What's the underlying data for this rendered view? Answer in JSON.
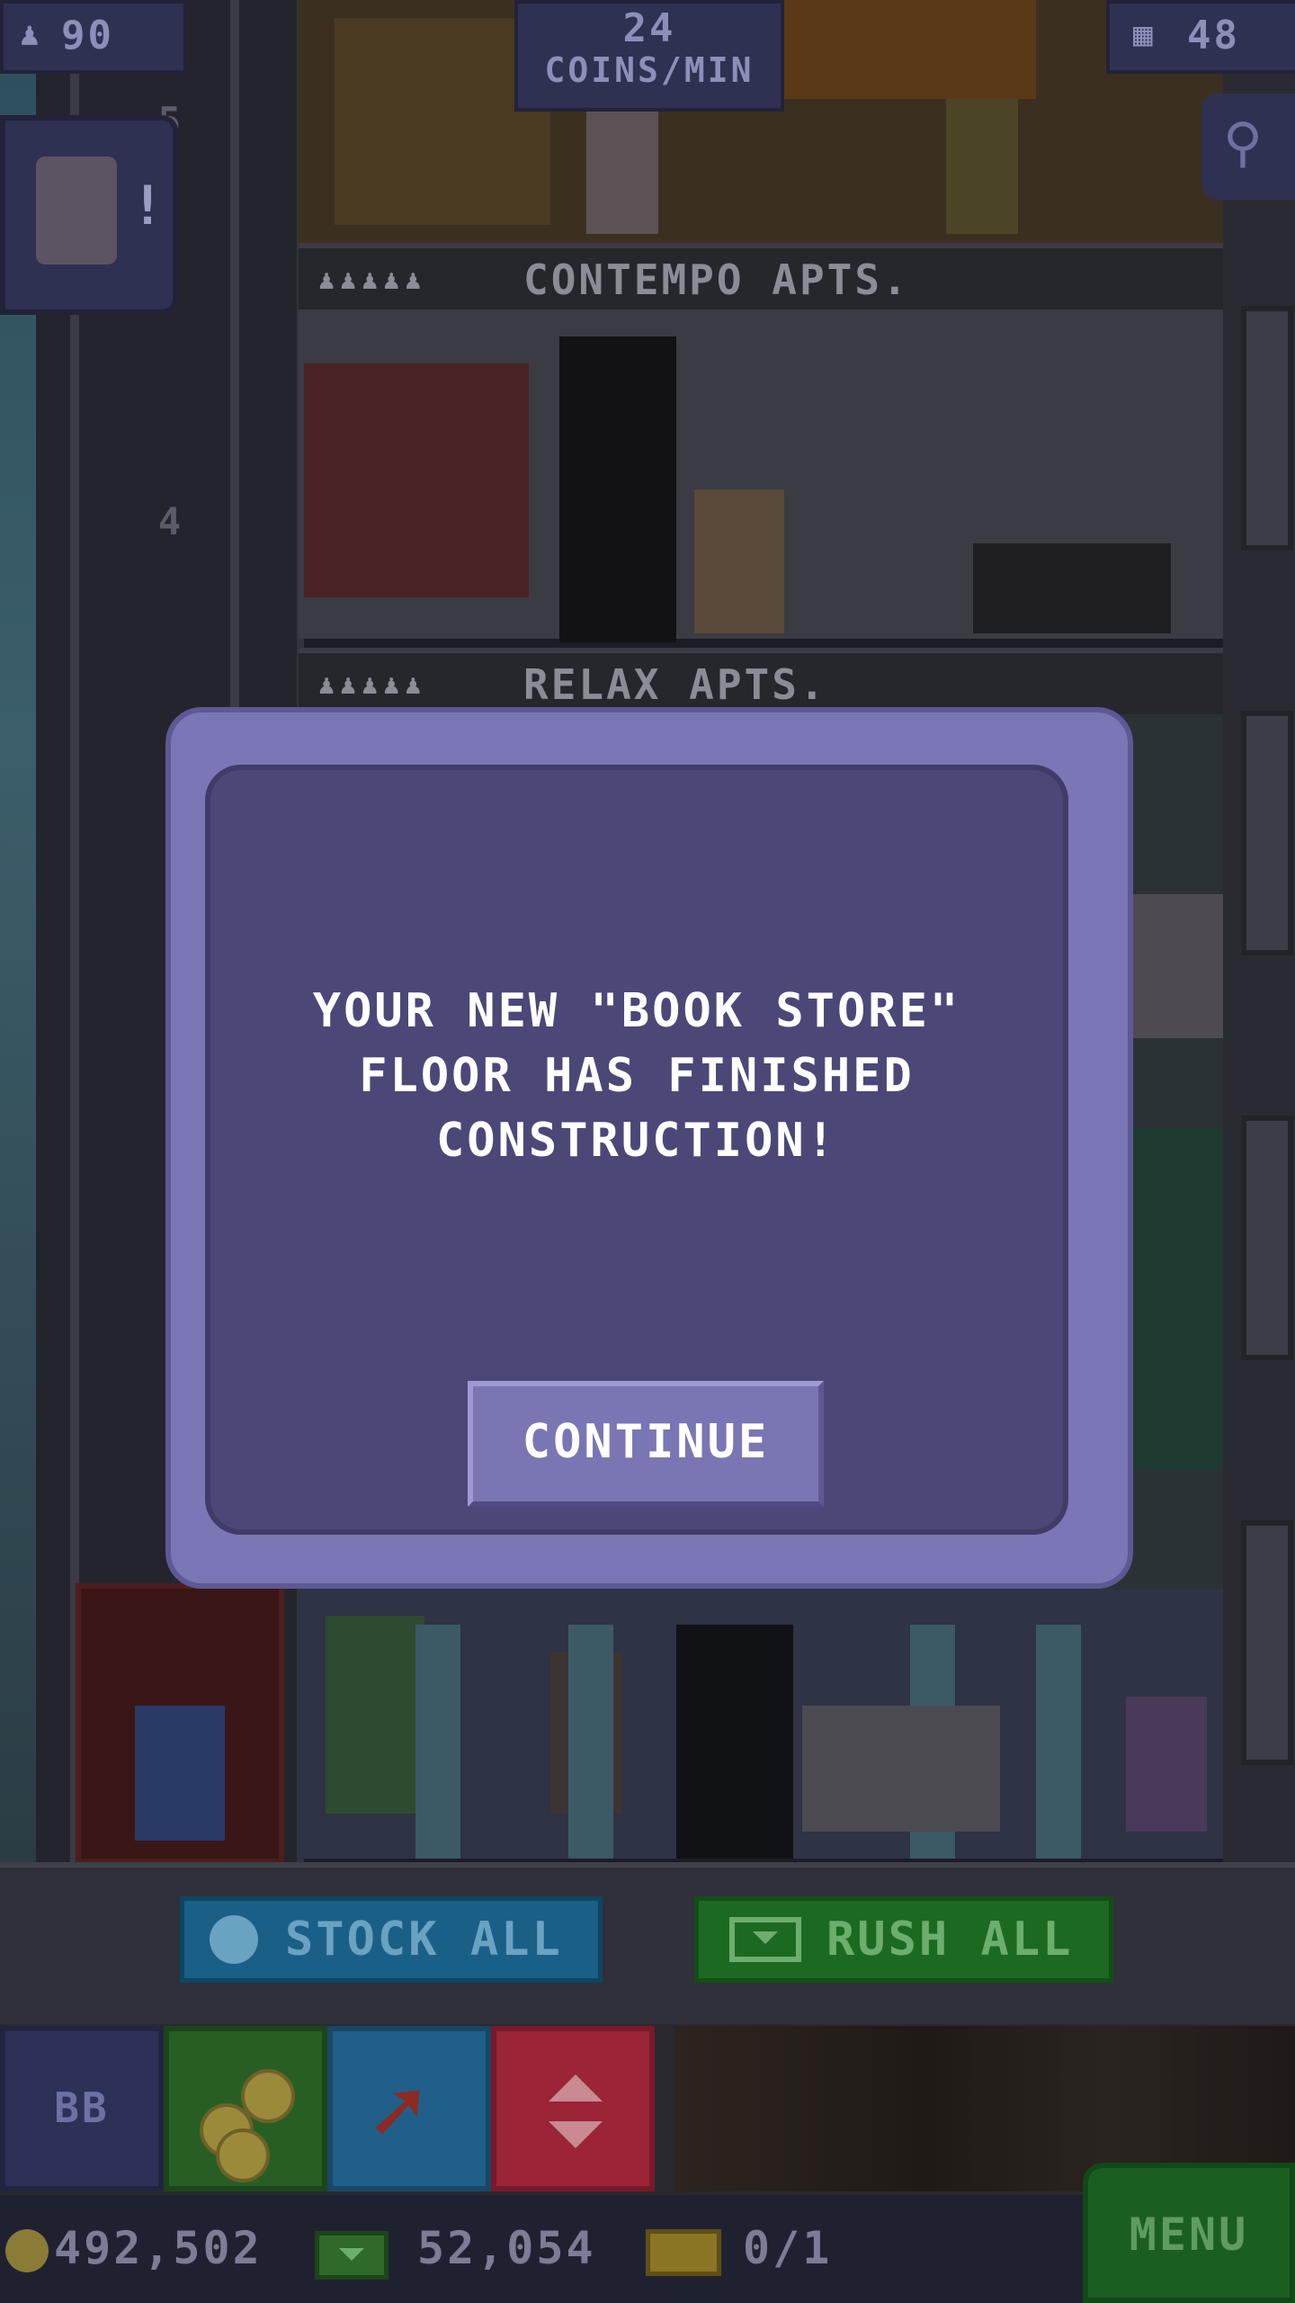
{
  "hud": {
    "population": "90",
    "population_icon": "person-icon",
    "coin_rate_value": "24",
    "coin_rate_unit": "COINS/MIN",
    "floor_count": "48",
    "floor_count_icon": "building-icon",
    "search_icon": "magnifier-icon"
  },
  "tower": {
    "floor_numbers": [
      "5",
      "4"
    ],
    "floors": [
      {
        "name": "CONTEMPO APTS.",
        "residents": "♟♟♟♟♟"
      },
      {
        "name": "RELAX APTS.",
        "residents": "♟♟♟♟♟"
      }
    ]
  },
  "dialog": {
    "message_line1": "YOUR NEW \"BOOK STORE\"",
    "message_line2": "FLOOR HAS FINISHED",
    "message_line3": "CONSTRUCTION!",
    "continue_label": "CONTINUE"
  },
  "actions": {
    "stock_all_label": "STOCK ALL",
    "rush_all_label": "RUSH ALL"
  },
  "toolbar": {
    "bb_label": "BB"
  },
  "currency": {
    "coins": "492,502",
    "bux": "52,054",
    "tickets": "0/1",
    "menu_label": "MENU"
  },
  "colors": {
    "dialog_frame": "#7b76b5",
    "dialog_body": "#4b4878",
    "stock_button": "#1a5f86",
    "rush_button": "#1c6a22",
    "menu_button": "#1b5e22"
  }
}
